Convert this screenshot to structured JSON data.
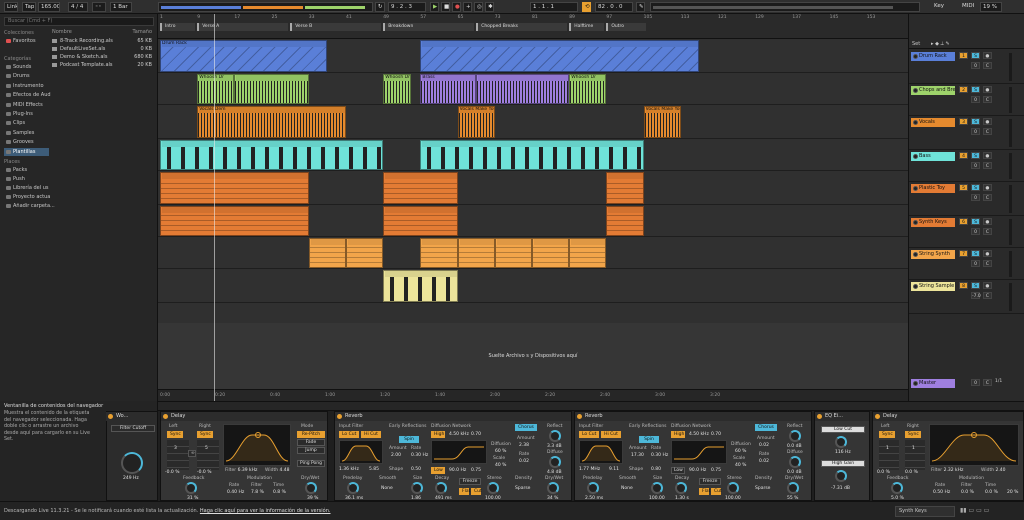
{
  "colors": {
    "accent": "#e8a030",
    "blue": "#5a7fd8",
    "green": "#9ed36b",
    "orange": "#e58a2e",
    "cyan": "#6fe3d9",
    "yellow": "#ece49a",
    "purple": "#9f7fe0",
    "deepOrange": "#e37b34",
    "lightOrange": "#f2a54a"
  },
  "topbar": {
    "link": "Link",
    "tap": "Tap",
    "tempo": "165.00",
    "sig": "4 / 4",
    "metro": "◦◦",
    "quant": "1 Bar",
    "pos": "9 . 2 . 3",
    "loopstart": "1 . 1 . 1",
    "looplen": "82 . 0 . 0",
    "key": "Key",
    "midi": "MIDI",
    "cpu": "19 %"
  },
  "browser": {
    "search_placeholder": "Buscar (Cmd + F)",
    "h_colecciones": "Colecciones",
    "favoritos": "Favoritos",
    "h_categorias": "Categorías",
    "categories": [
      "Sounds",
      "Drums",
      "Instrumento",
      "Efectos de Aud",
      "MIDI Effects",
      "Plug-Ins",
      "Clips",
      "Samples",
      "Grooves",
      "Plantillas"
    ],
    "h_places": "Places",
    "places": [
      "Packs",
      "Push",
      "Librería del us",
      "Proyecto actua",
      "Añadir carpeta..."
    ],
    "col_name": "Nombre",
    "col_size": "Tamaño",
    "files": [
      {
        "name": "8-Track Recording.als",
        "size": "65 KB"
      },
      {
        "name": "DefaultLiveSet.als",
        "size": "0 KB"
      },
      {
        "name": "Demo & Sketch.als",
        "size": "680 KB"
      },
      {
        "name": "Podcast Template.als",
        "size": "20 KB"
      }
    ]
  },
  "info": {
    "title": "Ventanilla de contenidos del navegador",
    "body": "Muestra el contenido de la etiqueta del navegador seleccionada. Haga doble clic o arrastre un archivo desde aquí para cargarlo en su Live Set."
  },
  "ruler": {
    "bars": [
      "1",
      "9",
      "17",
      "25",
      "33",
      "41",
      "49",
      "57",
      "65",
      "73",
      "81",
      "89",
      "97",
      "105",
      "113",
      "121",
      "129",
      "137",
      "145",
      "153"
    ],
    "locators": [
      "Intro",
      "Verse A",
      "Verse B",
      "Breakdown",
      "Chopped Breaks",
      "Halftime",
      "Outro"
    ],
    "times": [
      "0:00",
      "0:20",
      "0:40",
      "1:00",
      "1:20",
      "1:40",
      "2:00",
      "2:20",
      "2:40",
      "3:00",
      "3:20"
    ]
  },
  "dropzone": "Suelte Archivo s y Dispositivos aquí",
  "clips": {
    "whoosh": "Whoosh Dr",
    "vocals_dem": "Vocals Dem",
    "vocals_make": "Vocals Make You Mine",
    "brass": "Brass",
    "drum_rack": "Drum Rack"
  },
  "tracks": [
    {
      "name": "Drum Rack",
      "num": "1",
      "vol": "0"
    },
    {
      "name": "Chops and Bre",
      "num": "2",
      "vol": "0"
    },
    {
      "name": "Vocals",
      "num": "3",
      "vol": "0"
    },
    {
      "name": "Bass",
      "num": "4",
      "vol": "0"
    },
    {
      "name": "Plastic Toy",
      "num": "5",
      "vol": "0"
    },
    {
      "name": "Synth Keys",
      "num": "6",
      "vol": "0"
    },
    {
      "name": "String Synth",
      "num": "7",
      "vol": "0"
    },
    {
      "name": "String Sample",
      "num": "8",
      "vol": "-7.0"
    }
  ],
  "mixer_extra": {
    "vol5b": "95",
    "vol6b": "100",
    "set": "Set",
    "master": "Master",
    "master_num": "0",
    "page": "1/1"
  },
  "devices": {
    "autofilter": {
      "name": "Wo...",
      "param": "Filter Cutoff",
      "val": "249 Hz"
    },
    "delay1": {
      "name": "Delay",
      "left": "Left",
      "right": "Right",
      "sync": "Sync",
      "l_val": "3",
      "r_val": "5",
      "l_off": "-0.0 %",
      "r_off": "-0.0 %",
      "filter": "Filter",
      "f_val": "6.39 kHz",
      "width": "Width",
      "w_val": "4.48",
      "feedback": "Feedback",
      "fb_val": "31 %",
      "mod": "Modulation",
      "rate": "Rate",
      "rate_val": "0.40 Hz",
      "filter2": "Filter",
      "filter2_val": "7.8 %",
      "time": "Time",
      "time_val": "0.8 %",
      "mode": "Mode",
      "repitch": "Re-Pitch",
      "fade": "Fade",
      "jump": "Jump",
      "pingpong": "Ping Pong",
      "drywet": "Dry/Wet",
      "dw_val": "39 %"
    },
    "reverb1": {
      "name": "Reverb",
      "input": "Input Filter",
      "locut": "Lo Cut",
      "hicut": "Hi Cut",
      "freq": "1.36 kHz",
      "width": "5.85",
      "early": "Early Reflections",
      "spin": "Spin",
      "amount": "Amount",
      "rate": "Rate",
      "er_amt": "2.00",
      "er_rate": "0.30 Hz",
      "shape": "Shape",
      "shape_val": "0.50",
      "diff": "Diffusion Network",
      "high": "High",
      "highval": "4.50 kHz",
      "hv2": "0.70",
      "low": "Low",
      "lowval": "90.0 Hz",
      "lv2": "0.75",
      "diffusion": "Diffusion",
      "diffval": "60 %",
      "scale": "Scale",
      "scaleval": "40 %",
      "chorus": "Chorus",
      "camt": "2.38",
      "crate": "0.02",
      "reflect": "Reflect",
      "rf_val": "3.3 dB",
      "diffuse": "Diffuse",
      "df_val": "4.8 dB",
      "predelay": "Predelay",
      "pd_val": "36.1 ms",
      "smooth": "Smooth",
      "sm_val": "None",
      "size": "Size",
      "sz_val": "1.86",
      "decay": "Decay",
      "dc_val": "491 ms",
      "freeze": "Freeze",
      "flat": "Flat",
      "cut": "Cut",
      "stereo": "Stereo",
      "st_val": "100.00",
      "density": "Density",
      "dn_val": "Sparse",
      "drywet": "Dry/Wet",
      "dw_val": "34 %"
    },
    "reverb2": {
      "name": "Reverb",
      "freq": "1.77 MHz",
      "width": "9.11",
      "er_amt": "17.30",
      "er_rate": "0.30 Hz",
      "shape_val": "0.80",
      "highval": "4.50 kHz",
      "hv2": "0.70",
      "lowval": "90.0 Hz",
      "lv2": "0.75",
      "diffval": "60 %",
      "scaleval": "40 %",
      "camt": "0.02",
      "crate": "0.02",
      "rf_val": "0.0 dB",
      "df_val": "0.0 dB",
      "pd_val": "2.50 ms",
      "sm_val": "None",
      "sz_val": "100.00",
      "dc_val": "1.30 s",
      "st_val": "100.00",
      "dn_val": "Sparse",
      "dw_val": "55 %"
    },
    "eq": {
      "name": "EQ Ei...",
      "lowcut": "Low Cut",
      "lc_val": "116 Hz",
      "highgain": "High Gain",
      "hg_val": "-7.31 dB"
    },
    "delay2": {
      "name": "Delay",
      "l_val": "1",
      "r_val": "1",
      "l_off": "0.0 %",
      "r_off": "0.0 %",
      "f_val": "2.32 kHz",
      "w_val": "2.40",
      "fb_val": "5.0 %",
      "rate_val": "0.50 Hz",
      "filter2_val": "0.0 %",
      "time_val": "0.0 %",
      "dw_val": "20 %"
    }
  },
  "status": {
    "left": "Descargando Live 11.3.21 - Se le notificará cuando esté lista la actualización.",
    "link": "Haga clic aquí para ver la información de la versión.",
    "track": "Synth Keys"
  }
}
